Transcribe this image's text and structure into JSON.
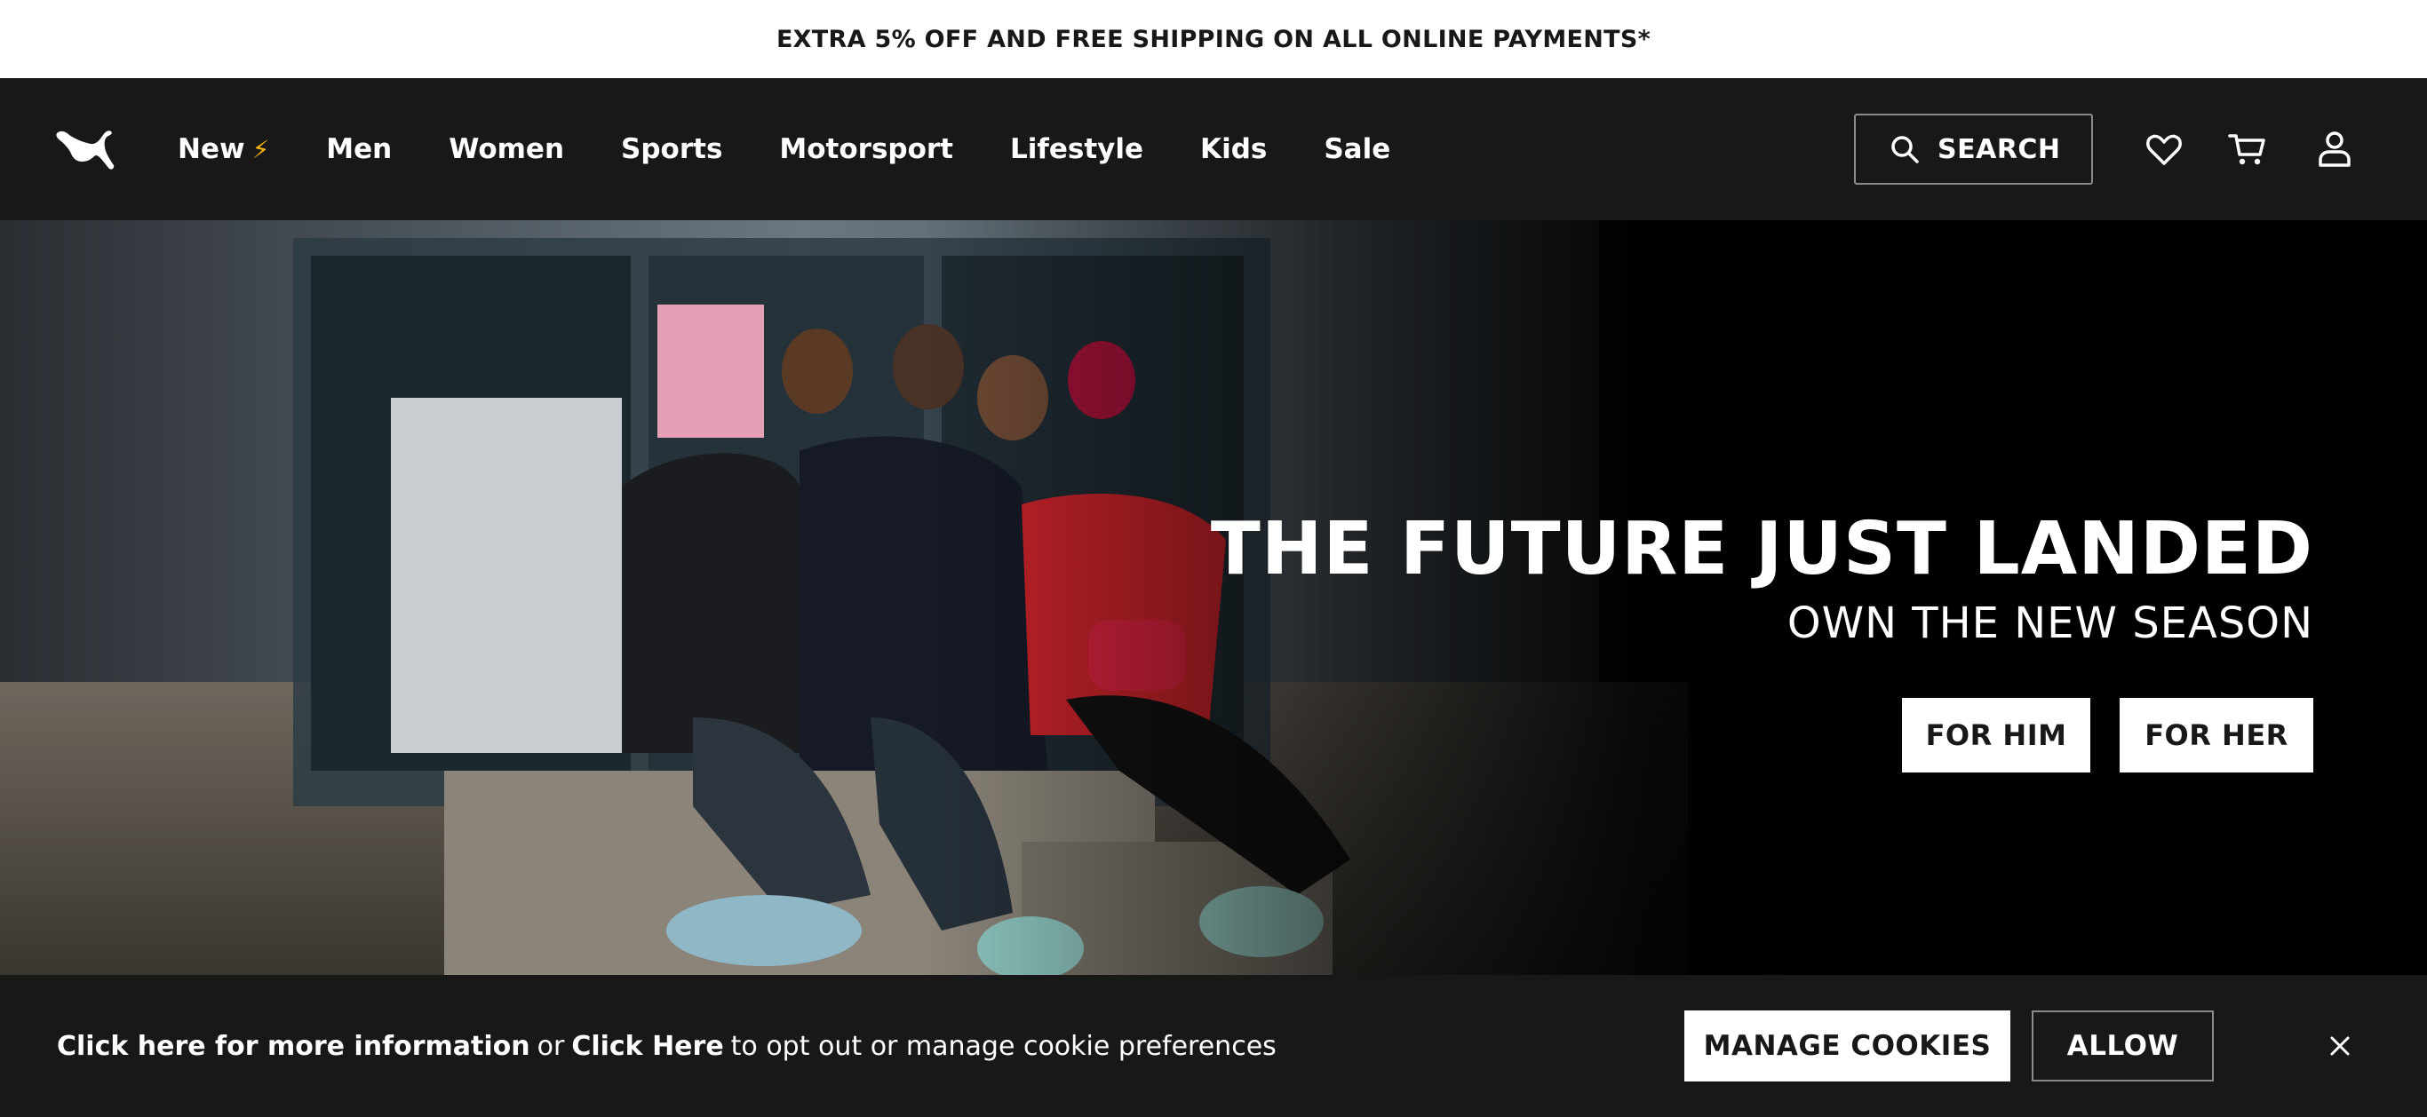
{
  "promo": {
    "text": "EXTRA 5% OFF AND FREE SHIPPING ON ALL ONLINE PAYMENTS*"
  },
  "header": {
    "logo_icon": "puma-cat-logo-icon",
    "nav": [
      {
        "label": "New",
        "icon": "lightning-bolt-icon",
        "icon_glyph": "⚡"
      },
      {
        "label": "Men"
      },
      {
        "label": "Women"
      },
      {
        "label": "Sports"
      },
      {
        "label": "Motorsport"
      },
      {
        "label": "Lifestyle"
      },
      {
        "label": "Kids"
      },
      {
        "label": "Sale"
      }
    ],
    "search_label": "SEARCH",
    "icons": [
      "wishlist-heart-icon",
      "cart-icon",
      "account-icon"
    ]
  },
  "hero": {
    "title": "THE FUTURE JUST LANDED",
    "subtitle": "OWN THE NEW SEASON",
    "buttons": {
      "him": "FOR HIM",
      "her": "FOR HER"
    }
  },
  "cookie": {
    "link_more": "Click here for more information",
    "or": "or",
    "link_optout": "Click Here",
    "rest": "to opt out or manage cookie preferences",
    "manage_label": "MANAGE COOKIES",
    "allow_label": "ALLOW"
  },
  "colors": {
    "background": "#181818",
    "white": "#ffffff",
    "bolt": "#f5b50a",
    "border": "#8a8a8a"
  }
}
